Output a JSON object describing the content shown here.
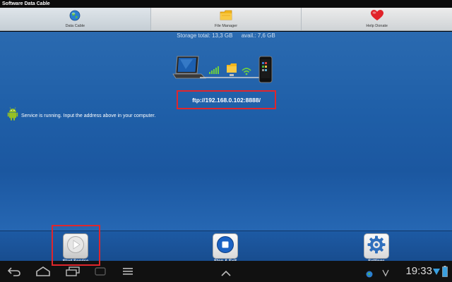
{
  "app": {
    "title": "Software Data Cable"
  },
  "tabs": [
    {
      "label": "Data Cable",
      "icon": "globe-icon",
      "active": true
    },
    {
      "label": "File Manager",
      "icon": "folder-icon",
      "active": false
    },
    {
      "label": "Help Donate",
      "icon": "heart-icon",
      "active": false
    }
  ],
  "storage": {
    "total": "Storage total: 13,3 GB",
    "avail": "avail.: 7,6 GB"
  },
  "ftp": {
    "address": "ftp://192.168.0.102:8888/"
  },
  "status": {
    "message": "Service is running. Input the address above in your computer."
  },
  "actions": {
    "start": "Start Service",
    "stop": "Stop & Exit",
    "settings": "Settings"
  },
  "system": {
    "clock": "19:33"
  },
  "colors": {
    "highlight": "#e0262c",
    "main_bg": "#1f5fa8"
  }
}
